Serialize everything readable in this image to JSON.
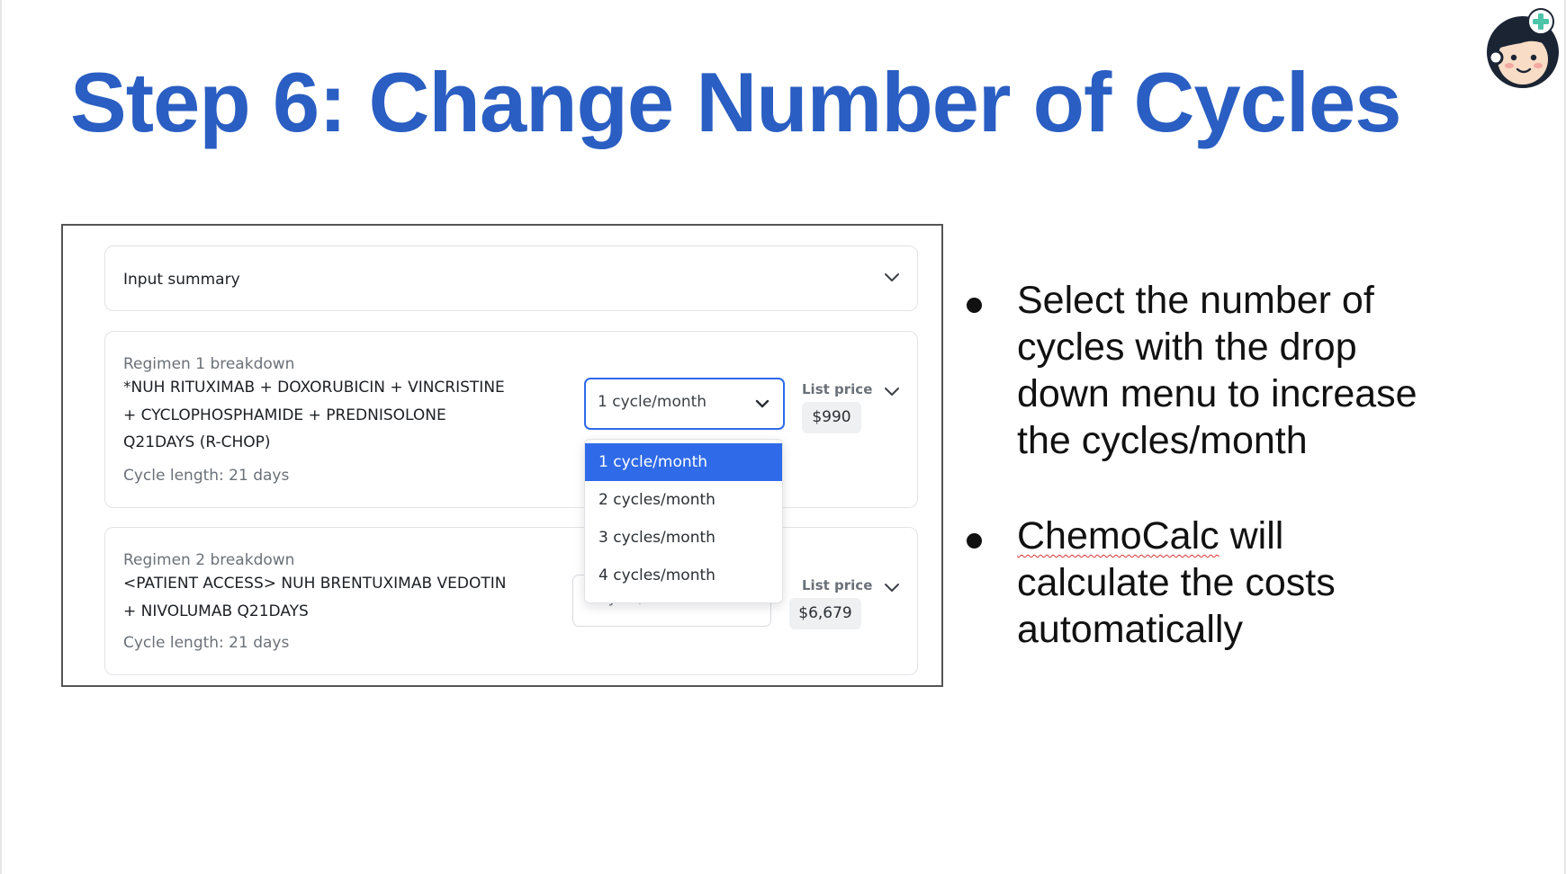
{
  "slide": {
    "title": "Step 6: Change Number of Cycles",
    "accent_color": "#2a5ec2",
    "mascot_icon": "doctor-mascot-icon"
  },
  "screenshot": {
    "input_summary": {
      "label": "Input summary",
      "icon": "chevron-down-icon"
    },
    "regimen1": {
      "heading": "Regimen 1 breakdown",
      "name_lines": [
        "*NUH RITUXIMAB + DOXORUBICIN + VINCRISTINE",
        "+ CYCLOPHOSPHAMIDE + PREDNISOLONE",
        "Q21DAYS (R-CHOP)"
      ],
      "cycle_length": "Cycle length: 21 days",
      "select_value": "1 cycle/month",
      "list_price_label": "List price",
      "list_price": "$990"
    },
    "regimen2": {
      "heading": "Regimen 2 breakdown",
      "name_lines": [
        "<PATIENT ACCESS> NUH BRENTUXIMAB VEDOTIN",
        "+ NIVOLUMAB Q21DAYS"
      ],
      "cycle_length": "Cycle length: 21 days",
      "select_value": "1 cycle/month",
      "list_price_label": "List price",
      "list_price": "$6,679"
    },
    "dropdown": {
      "options": [
        "1 cycle/month",
        "2 cycles/month",
        "3 cycles/month",
        "4 cycles/month"
      ],
      "selected_index": 0,
      "selected_color": "#2f6ae8"
    }
  },
  "bullets": [
    {
      "lines": [
        "Select the number of",
        "cycles with the drop",
        "down menu to increase",
        "the cycles/month"
      ]
    },
    {
      "lines": [
        "ChemoCalc",
        " will",
        "calculate the costs",
        "automatically"
      ]
    }
  ]
}
